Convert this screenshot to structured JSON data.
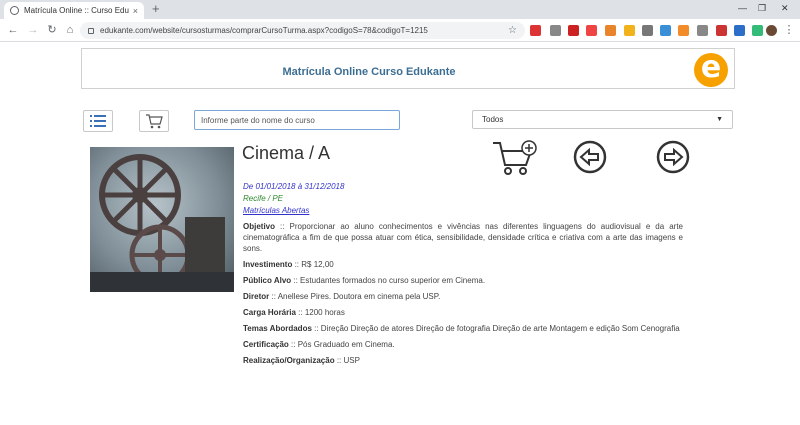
{
  "browser": {
    "tab_title": "Matrícula Online :: Curso Edukante",
    "tab_close": "×",
    "new_tab": "+",
    "url": "edukante.com/website/cursosturmas/comprarCursoTurma.aspx?codigoS=78&codigoT=1215"
  },
  "header": {
    "title": "Matrícula Online Curso Edukante",
    "logo_letter": "e"
  },
  "filters": {
    "search_placeholder": "Informe parte do nome do curso",
    "category_selected": "Todos"
  },
  "course": {
    "title": "Cinema / A",
    "dates": "De 01/01/2018 à 31/12/2018",
    "location": "Recife / PE",
    "status": "Matrículas Abertas",
    "objective_label": "Objetivo",
    "objective_text": ":: Proporcionar ao aluno conhecimentos e vivências nas diferentes linguagens do audiovisual e da arte cinematográfica a fim de que possa atuar com ética, sensibilidade, densidade crítica e criativa com a arte das imagens e sons.",
    "investment_label": "Investimento",
    "investment_text": ":: R$ 12,00",
    "audience_label": "Público Alvo",
    "audience_text": ":: Estudantes formados no curso superior em Cinema.",
    "director_label": "Diretor",
    "director_text": ":: Anellese Pires. Doutora em cinema pela USP.",
    "hours_label": "Carga Horária",
    "hours_text": ":: 1200 horas",
    "topics_label": "Temas Abordados",
    "topics_text": ":: Direção Direção de atores Direção de fotografia Direção de arte Montagem e edição Som Cenografia",
    "cert_label": "Certificação",
    "cert_text": ":: Pós Graduado em Cinema.",
    "org_label": "Realização/Organização",
    "org_text": ":: USP"
  },
  "colors": {
    "accent": "#3c6e93",
    "logo": "#f7a100",
    "date": "#3333cc",
    "location": "#2e8b2e"
  }
}
